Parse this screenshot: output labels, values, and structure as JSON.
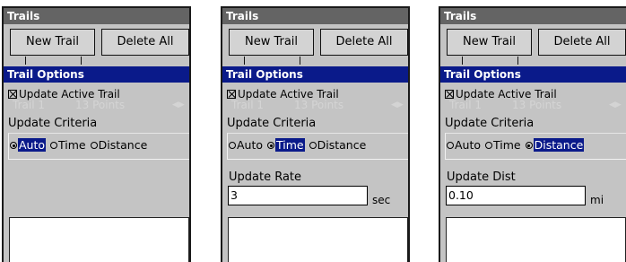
{
  "screens": [
    {
      "title": "Trails",
      "new_trail": "New Trail",
      "delete_all": "Delete All",
      "panel_title": "Trail Options",
      "checkbox_label": "Update Active Trail",
      "ghost_name": "Trail 1",
      "ghost_points": "13 Points",
      "group_label": "Update Criteria",
      "options": [
        "Auto",
        "Time",
        "Distance"
      ],
      "selected": "Auto",
      "field_label": "",
      "field_value": "",
      "field_unit": ""
    },
    {
      "title": "Trails",
      "new_trail": "New Trail",
      "delete_all": "Delete All",
      "panel_title": "Trail Options",
      "checkbox_label": "Update Active Trail",
      "ghost_name": "Trail 1",
      "ghost_points": "13 Points",
      "group_label": "Update Criteria",
      "options": [
        "Auto",
        "Time",
        "Distance"
      ],
      "selected": "Time",
      "field_label": "Update Rate",
      "field_value": "3",
      "field_unit": "sec"
    },
    {
      "title": "Trails",
      "new_trail": "New Trail",
      "delete_all": "Delete All",
      "panel_title": "Trail Options",
      "checkbox_label": "Update Active Trail",
      "ghost_name": "Trail 1",
      "ghost_points": "13 Points",
      "group_label": "Update Criteria",
      "options": [
        "Auto",
        "Time",
        "Distance"
      ],
      "selected": "Distance",
      "field_label": "Update Dist",
      "field_value": "0.10",
      "field_unit": "mi"
    }
  ],
  "colors": {
    "titlebar": "#646464",
    "panel_title": "#0a1a8a",
    "background": "#c4c4c4",
    "selection": "#0a1a8a"
  },
  "icons": {
    "checkbox": "checkbox-checked-icon",
    "radio": "radio-button-icon",
    "ghost_arrow": "right-arrow-icon"
  }
}
